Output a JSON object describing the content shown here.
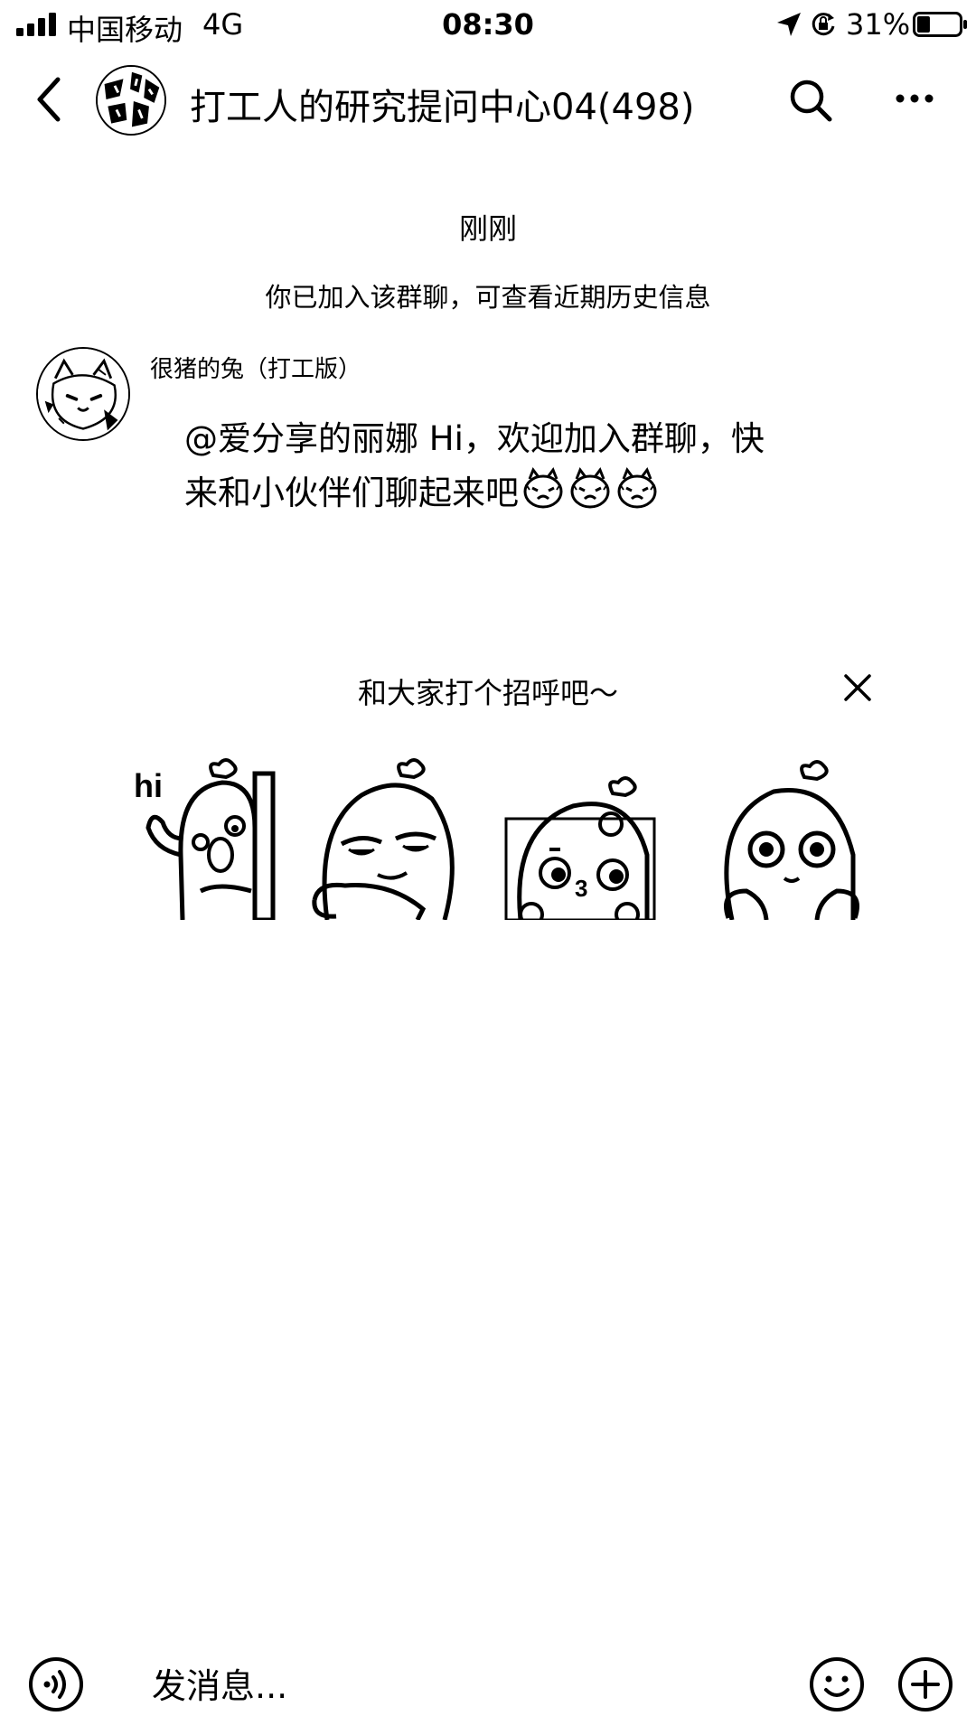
{
  "status_bar": {
    "carrier": "中国移动",
    "network": "4G",
    "time": "08:30",
    "battery": "31%",
    "battery_level": 0.31,
    "icons": [
      "signal-icon",
      "location-icon",
      "rotation-lock-icon",
      "battery-icon"
    ]
  },
  "header": {
    "title": "打工人的研究提问中心04(498)",
    "icons": [
      "back-icon",
      "group-avatar",
      "search-icon",
      "more-icon"
    ]
  },
  "chat": {
    "time_separator": "刚刚",
    "system_notice": "你已加入该群聊，可查看近期历史信息",
    "messages": [
      {
        "sender": "很猪的兔（打工版）",
        "text": "@爱分享的丽娜 Hi，欢迎加入群聊，快来和小伙伴们聊起来吧",
        "emoji_count": 3,
        "emoji_icon": "cat-face-emoji-icon"
      }
    ]
  },
  "greeting_panel": {
    "title": "和大家打个招呼吧～",
    "stickers": [
      {
        "name": "sticker-hi",
        "caption": "hi"
      },
      {
        "name": "sticker-smirk",
        "caption": ""
      },
      {
        "name": "sticker-kiss",
        "caption": ""
      },
      {
        "name": "sticker-sparkle-eyes",
        "caption": ""
      }
    ]
  },
  "input_bar": {
    "placeholder": "发消息...",
    "icons": [
      "voice-icon",
      "emoji-icon",
      "plus-icon"
    ]
  }
}
